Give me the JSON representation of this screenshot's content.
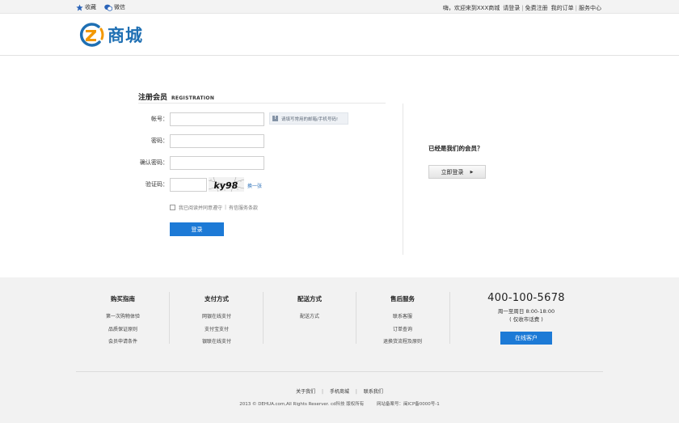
{
  "topbar": {
    "favorite_label": "收藏",
    "wechat_label": "微信",
    "welcome": "嗨，欢迎来到XXX商城",
    "login_link": "请登录",
    "register_link": "免费注册",
    "orders_link": "我的订单",
    "service_link": "服务中心"
  },
  "header": {
    "logo_text": "商城",
    "brand_color": "#1e6fb3",
    "accent_color": "#f39800"
  },
  "registration": {
    "title_cn": "注册会员",
    "title_en": "REGISTRATION",
    "fields": [
      {
        "label": "帐号：",
        "value": ""
      },
      {
        "label": "密码：",
        "value": ""
      },
      {
        "label": "确认密码：",
        "value": ""
      },
      {
        "label": "验证码：",
        "value": ""
      }
    ],
    "hint": "请填写常用的邮箱/手机号码!",
    "captcha_text": "ky98",
    "refresh_link": "换一张",
    "agree_text": "我已阅读并同意遵守",
    "terms_link": "有信服务条款",
    "submit_label": "登录"
  },
  "member": {
    "question": "已经是我们的会员？",
    "login_button": "立即登录"
  },
  "footer": {
    "columns": [
      {
        "title": "购买指南",
        "links": [
          "第一次购物体验",
          "品质保证原则",
          "会员申请条件"
        ]
      },
      {
        "title": "支付方式",
        "links": [
          "网银在线支付",
          "支付宝支付",
          "银联在线支付"
        ]
      },
      {
        "title": "配送方式",
        "links": [
          "配送方式"
        ]
      },
      {
        "title": "售后服务",
        "links": [
          "联系客服",
          "订单查询",
          "退换货流程及原则"
        ]
      }
    ],
    "phone": "400-100-5678",
    "hours_line1": "周一至周日 8:00-18:00",
    "hours_line2": "( 仅收市话费 )",
    "online_button": "在线客户",
    "bottom_links": [
      "关于我们",
      "手机商城",
      "联系我们"
    ],
    "copyright": "2013 © DEHUA.com,All Rights Reserver. cd科技 版权所有",
    "icp": "网站备案号：闽ICP备0000号-1"
  }
}
